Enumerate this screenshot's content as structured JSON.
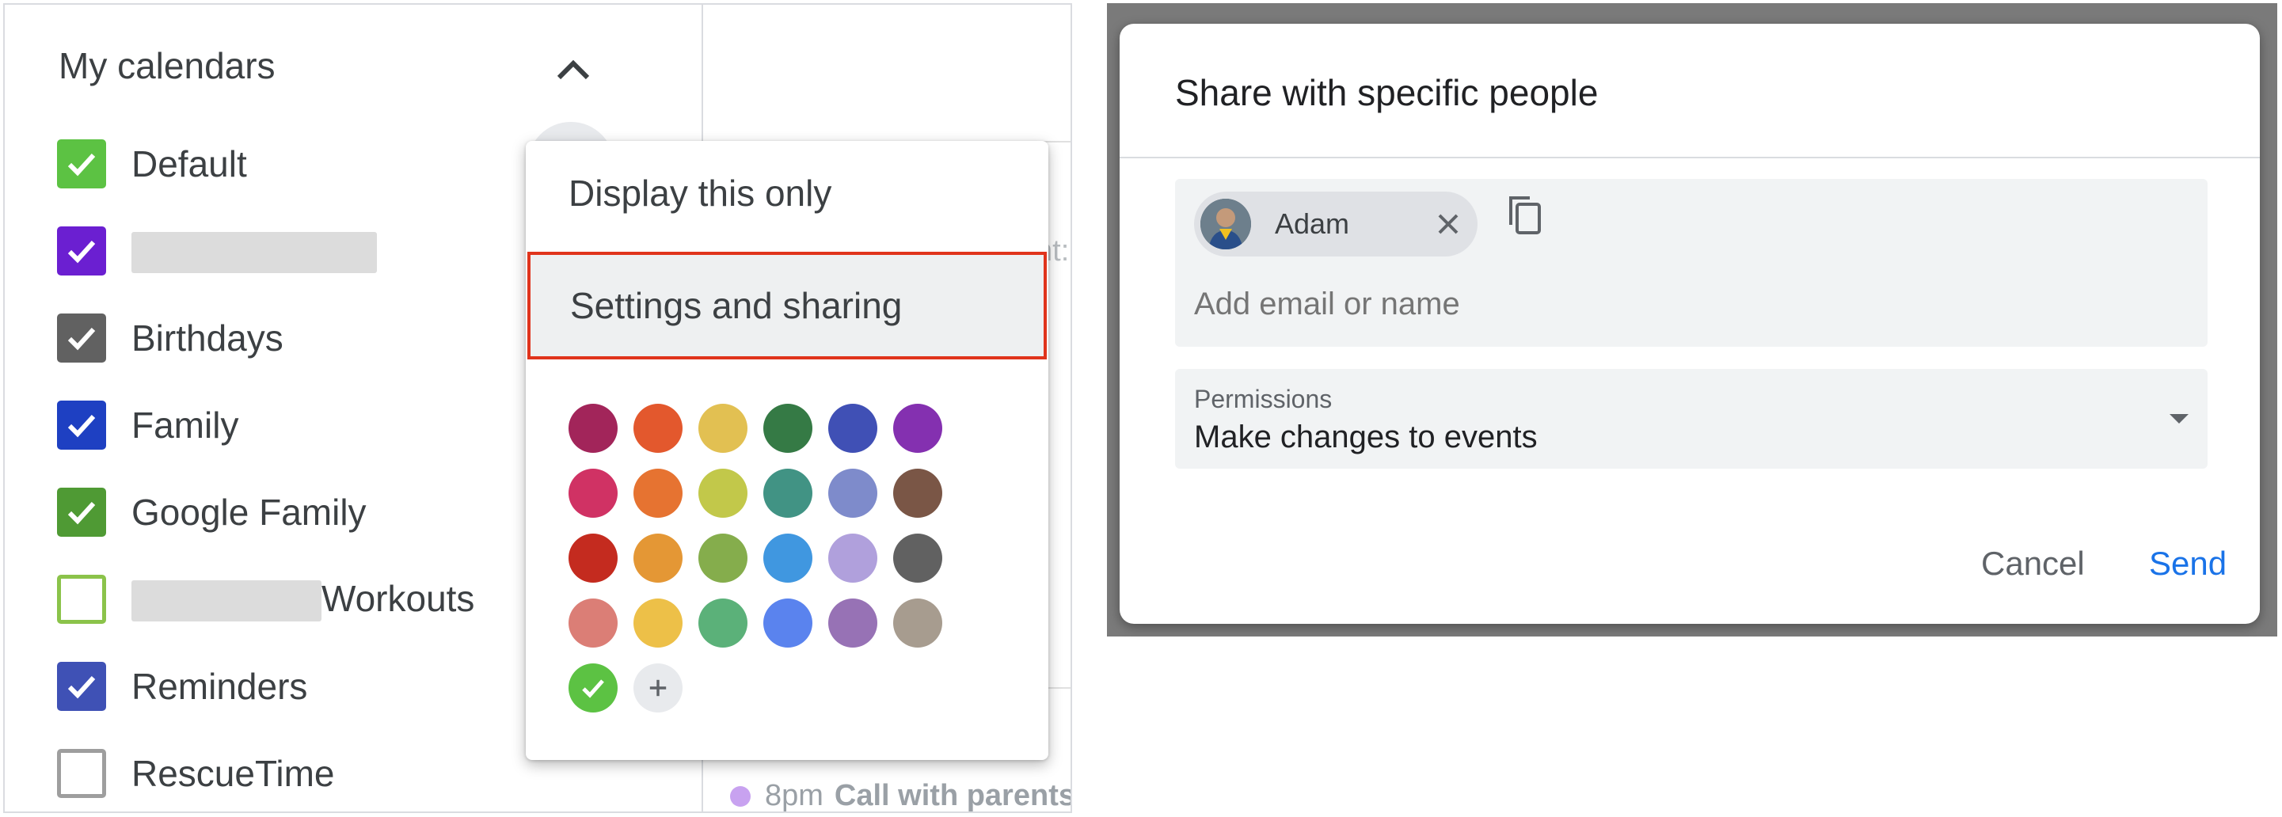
{
  "sidebar": {
    "title": "My calendars",
    "calendars": [
      {
        "label": "Default",
        "color": "#5cc243",
        "checked": true
      },
      {
        "label": "",
        "color": "#6b1fd1",
        "checked": true,
        "redacted": true
      },
      {
        "label": "Birthdays",
        "color": "#616161",
        "checked": true
      },
      {
        "label": "Family",
        "color": "#1e40c2",
        "checked": true
      },
      {
        "label": "Google Family",
        "color": "#4f9a34",
        "checked": true
      },
      {
        "label": "Workouts",
        "color": "#8bc34a",
        "checked": false,
        "redacted_prefix": true
      },
      {
        "label": "Reminders",
        "color": "#3f51b5",
        "checked": true
      },
      {
        "label": "RescueTime",
        "color": "#9e9e9e",
        "checked": false
      }
    ]
  },
  "popup_menu": {
    "items": [
      {
        "label": "Display this only"
      },
      {
        "label": "Settings and sharing",
        "highlighted": true
      }
    ],
    "colors": [
      [
        "#a2255a",
        "#e3582d",
        "#e2c052",
        "#357a45",
        "#4050b5",
        "#8430b0"
      ],
      [
        "#d03264",
        "#e67331",
        "#c2c84a",
        "#419384",
        "#7e8bcb",
        "#7a5646"
      ],
      [
        "#c42b1f",
        "#e49735",
        "#85ad4c",
        "#4097e0",
        "#b0a0dc",
        "#616161"
      ],
      [
        "#db7e76",
        "#edc048",
        "#5bb179",
        "#5a83ee",
        "#9772b5",
        "#a79c8f"
      ]
    ],
    "selected_color": "#5cc243",
    "add_color_icon": "plus-icon"
  },
  "background_event": {
    "time": "8pm",
    "title": "Call with parents"
  },
  "share_dialog": {
    "title": "Share with specific people",
    "person_chip": {
      "name": "Adam"
    },
    "add_placeholder": "Add email or name",
    "permissions": {
      "label": "Permissions",
      "value": "Make changes to events"
    },
    "cancel_label": "Cancel",
    "send_label": "Send"
  }
}
